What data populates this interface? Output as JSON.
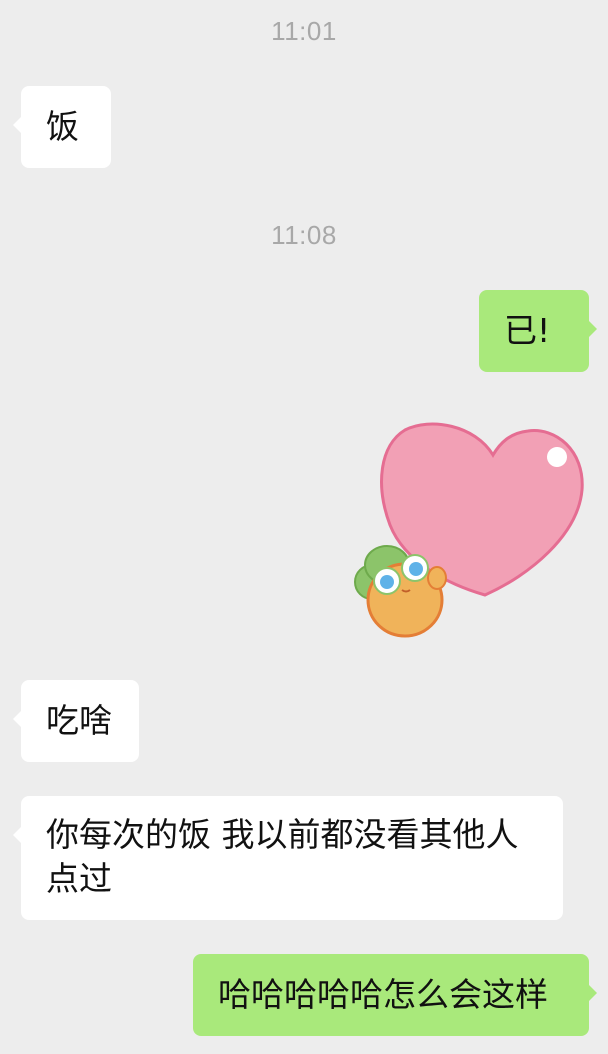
{
  "chat": {
    "timestamps": [
      "11:01",
      "11:08"
    ],
    "messages": [
      {
        "side": "in",
        "text": "饭"
      },
      {
        "side": "out",
        "text": "已!"
      },
      {
        "side": "out",
        "type": "sticker",
        "sticker": "heart-sticker"
      },
      {
        "side": "in",
        "text": "吃啥"
      },
      {
        "side": "in",
        "text": "你每次的饭 我以前都没看其他人点过"
      },
      {
        "side": "out",
        "text": "哈哈哈哈哈怎么会这样"
      }
    ]
  },
  "colors": {
    "background": "#ededed",
    "incoming_bubble": "#ffffff",
    "outgoing_bubble": "#a9e97b",
    "timestamp_text": "#a8a8a8",
    "heart": "#f2a0b5",
    "heart_outline": "#e56d92"
  }
}
